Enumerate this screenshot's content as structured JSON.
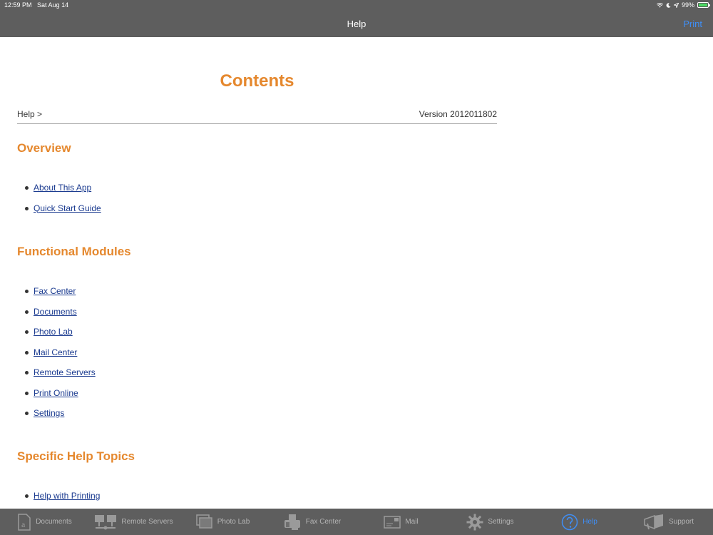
{
  "status": {
    "time": "12:59 PM",
    "date": "Sat Aug 14",
    "battery": "99%",
    "battery_level": 0.99
  },
  "nav": {
    "title": "Help",
    "print": "Print"
  },
  "doc": {
    "title": "Contents",
    "breadcrumb": "Help >",
    "version": "Version 2012011802",
    "sections": [
      {
        "heading": "Overview",
        "links": [
          "About This App",
          "Quick Start Guide"
        ]
      },
      {
        "heading": "Functional Modules",
        "links": [
          "Fax Center",
          "Documents",
          "Photo Lab",
          "Mail Center",
          "Remote Servers",
          "Print Online",
          "Settings"
        ]
      },
      {
        "heading": "Specific Help Topics",
        "links": [
          "Help with Printing"
        ]
      }
    ]
  },
  "tabs": [
    {
      "label": "Documents",
      "icon": "documents-icon"
    },
    {
      "label": "Remote Servers",
      "icon": "remote-servers-icon"
    },
    {
      "label": "Photo Lab",
      "icon": "photo-lab-icon"
    },
    {
      "label": "Fax Center",
      "icon": "fax-icon"
    },
    {
      "label": "Mail",
      "icon": "mail-icon"
    },
    {
      "label": "Settings",
      "icon": "gear-icon"
    },
    {
      "label": "Help",
      "icon": "help-icon",
      "active": true
    },
    {
      "label": "Support",
      "icon": "support-icon"
    }
  ],
  "colors": {
    "accent": "#e5882e",
    "link": "#1a3a8f",
    "tint": "#3f8ef5",
    "bar": "#5e5e5e"
  }
}
